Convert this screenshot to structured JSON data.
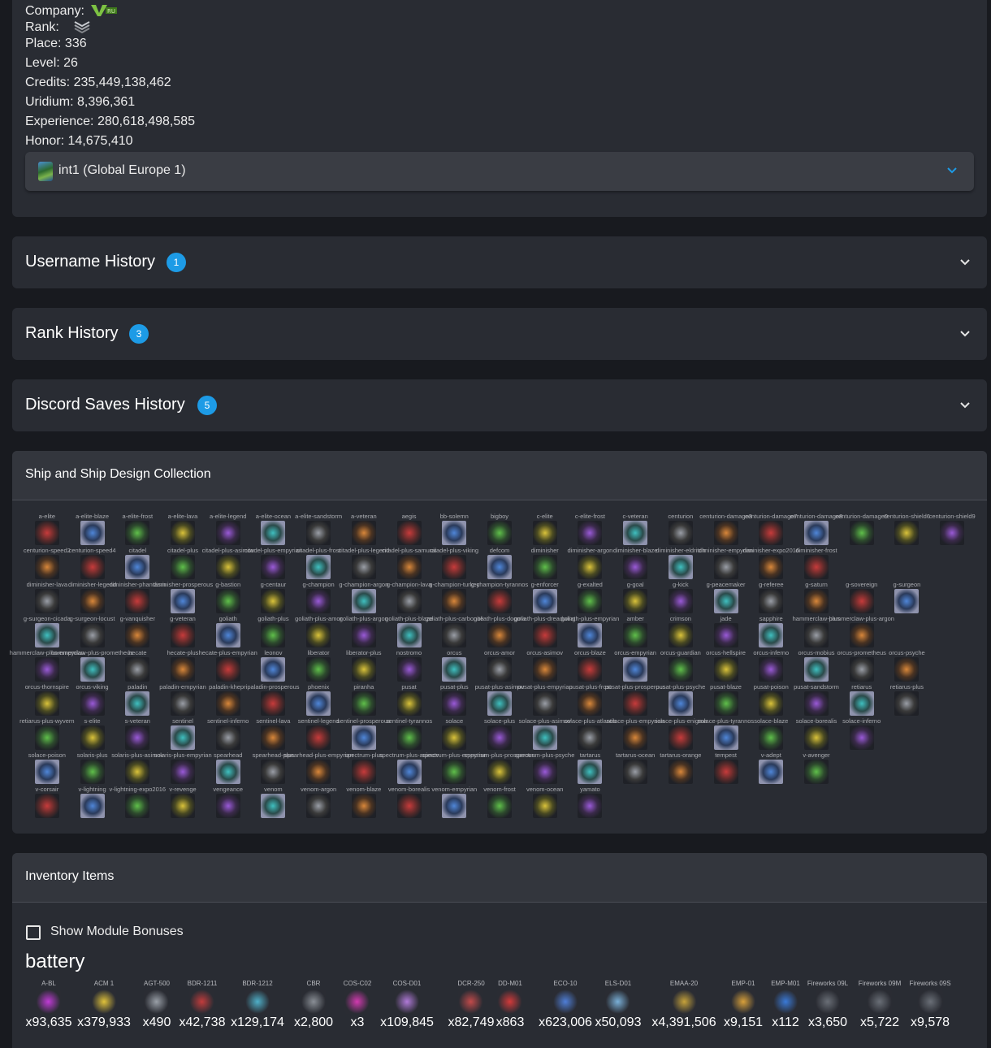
{
  "profile": {
    "company_label": "Company:",
    "rank_label": "Rank:",
    "place": "Place: 336",
    "level": "Level: 26",
    "credits": "Credits: 235,449,138,462",
    "uridium": "Uridium: 8,396,361",
    "experience": "Experience: 280,618,498,585",
    "honor": "Honor: 14,675,410",
    "server": "int1 (Global Europe 1)",
    "company_logo": "vru-logo",
    "rank_icon": "rank-chevrons-icon"
  },
  "accordions": [
    {
      "title": "Username History",
      "count": "1"
    },
    {
      "title": "Rank History",
      "count": "3"
    },
    {
      "title": "Discord Saves History",
      "count": "5"
    }
  ],
  "ships": {
    "title": "Ship and Ship Design Collection",
    "rows": [
      [
        "a-elite",
        "a-elite-blaze",
        "a-elite-frost",
        "a-elite-lava",
        "a-elite-legend",
        "a-elite-ocean",
        "a-elite-sandstorm",
        "a-veteran",
        "aegis",
        "bb-solemn",
        "bigboy",
        "c-elite",
        "c-elite-frost",
        "c-veteran",
        "centurion",
        "centurion-damage3",
        "centurion-damage7",
        "centurion-damage8",
        "centurion-damage9",
        "centurion-shield6",
        "centurion-shield9"
      ],
      [
        "centurion-speed2",
        "centurion-speed4",
        "citadel",
        "citadel-plus",
        "citadel-plus-asimov",
        "citadel-plus-empyrian",
        "citadel-plus-frost",
        "citadel-plus-legend",
        "citadel-plus-samurai",
        "citadel-plus-viking",
        "defcom",
        "diminisher",
        "diminisher-argon",
        "diminisher-blaze",
        "diminisher-eldritch",
        "diminisher-empyrian",
        "diminisher-expo2016",
        "diminisher-frost"
      ],
      [
        "diminisher-lava",
        "diminisher-legend",
        "diminisher-phantasm",
        "diminisher-prosperous",
        "g-bastion",
        "g-centaur",
        "g-champion",
        "g-champion-argon",
        "g-champion-lava",
        "g-champion-turkey",
        "g-champion-tyrannos",
        "g-enforcer",
        "g-exalted",
        "g-goal",
        "g-kick",
        "g-peacemaker",
        "g-referee",
        "g-saturn",
        "g-sovereign",
        "g-surgeon"
      ],
      [
        "g-surgeon-cicada",
        "g-surgeon-locust",
        "g-vanquisher",
        "g-veteran",
        "goliath",
        "goliath-plus",
        "goliath-plus-amor",
        "goliath-plus-argon",
        "goliath-plus-blaze",
        "goliath-plus-carbonite",
        "goliath-plus-dogma",
        "goliath-plus-dreadwing",
        "goliath-plus-empyrian",
        "amber",
        "crimson",
        "jade",
        "sapphire",
        "hammerclaw-plus",
        "hammerclaw-plus-argon"
      ],
      [
        "hammerclaw-plus-empyrian",
        "hammerclaw-plus-prometheus",
        "hecate",
        "hecate-plus",
        "hecate-plus-empyrian",
        "leonov",
        "liberator",
        "liberator-plus",
        "nostromo",
        "orcus",
        "orcus-amor",
        "orcus-asimov",
        "orcus-blaze",
        "orcus-empyrian",
        "orcus-guardian",
        "orcus-hellspire",
        "orcus-inferno",
        "orcus-mobius",
        "orcus-prometheus",
        "orcus-psyche"
      ],
      [
        "orcus-thornspire",
        "orcus-viking",
        "paladin",
        "paladin-empyrian",
        "paladin-khepri",
        "paladin-prosperous",
        "phoenix",
        "piranha",
        "pusat",
        "pusat-plus",
        "pusat-plus-asimov",
        "pusat-plus-empyrian",
        "pusat-plus-frost",
        "pusat-plus-prosperous",
        "pusat-plus-psyche",
        "pusat-blaze",
        "pusat-poison",
        "pusat-sandstorm",
        "retiarus",
        "retiarus-plus"
      ],
      [
        "retiarus-plus-wyvern",
        "s-elite",
        "s-veteran",
        "sentinel",
        "sentinel-inferno",
        "sentinel-lava",
        "sentinel-legend",
        "sentinel-prosperous",
        "sentinel-tyrannos",
        "solace",
        "solace-plus",
        "solace-plus-asimov",
        "solace-plus-atlantis",
        "solace-plus-empyrian",
        "solace-plus-enigma",
        "solace-plus-tyrannos",
        "solace-blaze",
        "solace-borealis",
        "solace-inferno"
      ],
      [
        "solace-poison",
        "solaris-plus",
        "solaris-plus-asimov",
        "solaris-plus-empyrian",
        "spearhead",
        "spearhead-plus",
        "spearhead-plus-empyrian",
        "spectrum-plus",
        "spectrum-plus-asimov",
        "spectrum-plus-empyrian",
        "spectrum-plus-prosperous",
        "spectrum-plus-psyche",
        "tartarus",
        "tartarus-ocean",
        "tartarus-orange",
        "tempest",
        "v-adept",
        "v-avenger"
      ],
      [
        "v-corsair",
        "v-lightning",
        "v-lightning-expo2016",
        "v-revenge",
        "vengeance",
        "venom",
        "venom-argon",
        "venom-blaze",
        "venom-borealis",
        "venom-empyrian",
        "venom-frost",
        "venom-ocean",
        "yamato"
      ]
    ]
  },
  "inventory": {
    "title": "Inventory Items",
    "show_bonuses_label": "Show Module Bonuses",
    "category": "battery",
    "items": [
      {
        "name": "A-BL",
        "count": "x93,635"
      },
      {
        "name": "ACM 1",
        "count": "x379,933"
      },
      {
        "name": "AGT-500",
        "count": "x490"
      },
      {
        "name": "BDR-1211",
        "count": "x42,738"
      },
      {
        "name": "BDR-1212",
        "count": "x129,174"
      },
      {
        "name": "CBR",
        "count": "x2,800"
      },
      {
        "name": "COS-C02",
        "count": "x3"
      },
      {
        "name": "COS-D01",
        "count": "x109,845"
      },
      {
        "name": "DCR-250",
        "count": "x82,749"
      },
      {
        "name": "DD-M01",
        "count": "x863"
      },
      {
        "name": "ECO-10",
        "count": "x623,006"
      },
      {
        "name": "ELS-D01",
        "count": "x50,093"
      },
      {
        "name": "EMAA-20",
        "count": "x4,391,506"
      },
      {
        "name": "EMP-01",
        "count": "x9,151"
      },
      {
        "name": "EMP-M01",
        "count": "x112"
      },
      {
        "name": "Fireworks 09L",
        "count": "x3,650"
      },
      {
        "name": "Fireworks 09M",
        "count": "x5,722"
      },
      {
        "name": "Fireworks 09S",
        "count": "x9,578"
      }
    ]
  },
  "colors": {
    "accent": "#1d9be6",
    "card": "#292c33",
    "background": "#181a1f"
  }
}
